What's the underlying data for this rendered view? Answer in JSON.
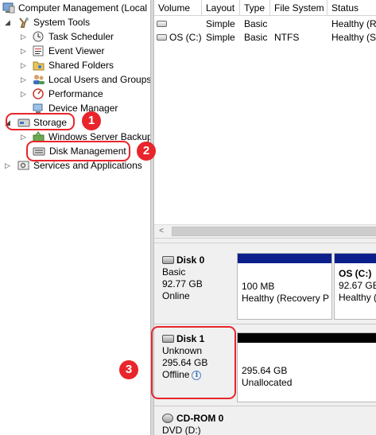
{
  "tree": {
    "root": "Computer Management (Local",
    "system_tools": "System Tools",
    "task_scheduler": "Task Scheduler",
    "event_viewer": "Event Viewer",
    "shared_folders": "Shared Folders",
    "local_users": "Local Users and Groups",
    "performance": "Performance",
    "device_manager": "Device Manager",
    "storage": "Storage",
    "windows_server_backup": "Windows Server Backup",
    "disk_management": "Disk Management",
    "services": "Services and Applications"
  },
  "volume_list": {
    "headers": [
      "Volume",
      "Layout",
      "Type",
      "File System",
      "Status"
    ],
    "rows": [
      {
        "volume": "",
        "layout": "Simple",
        "type": "Basic",
        "fs": "",
        "status": "Healthy (R"
      },
      {
        "volume": "OS (C:)",
        "layout": "Simple",
        "type": "Basic",
        "fs": "NTFS",
        "status": "Healthy (S"
      }
    ]
  },
  "disks": {
    "disk0": {
      "name": "Disk 0",
      "type": "Basic",
      "size": "92.77 GB",
      "state": "Online",
      "p1_size": "100 MB",
      "p1_status": "Healthy (Recovery P",
      "p2_name": "OS  (C:)",
      "p2_size": "92.67 GB",
      "p2_status": "Healthy ("
    },
    "disk1": {
      "name": "Disk 1",
      "type": "Unknown",
      "size": "295.64 GB",
      "state": "Offline",
      "p1_size": "295.64 GB",
      "p1_status": "Unallocated"
    },
    "cdrom0": {
      "name": "CD-ROM 0",
      "drive": "DVD (D:)"
    }
  },
  "annotations": {
    "b1": "1",
    "b2": "2",
    "b3": "3"
  },
  "colors": {
    "annotation": "#e8252b",
    "primary_partition": "#0b1f8c",
    "unallocated": "#000000"
  }
}
